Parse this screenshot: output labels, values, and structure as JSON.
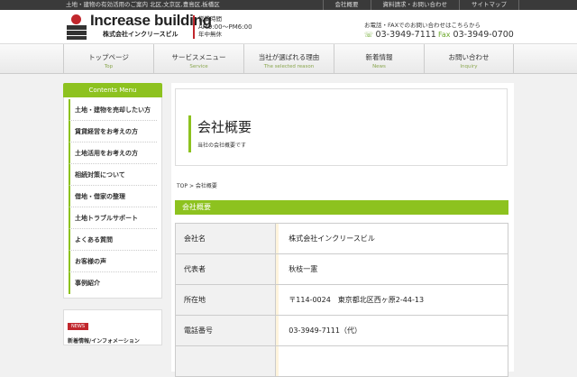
{
  "topbar": {
    "tagline": "土地・建物の有効活用のご案内 北区,文京区,豊島区,板橋区",
    "links": [
      "会社概要",
      "資料請求・お問い合わせ",
      "サイトマップ"
    ]
  },
  "header": {
    "logo_name": "Increase building",
    "logo_sub": "株式会社インクリースビル",
    "hours_label": "営業時間",
    "hours_time": "AM9:00～PM6:00",
    "hours_note": "年中無休",
    "contact_lead": "お電話・FAXでのお問い合わせはこちらから",
    "tel": "03-3949-7111",
    "fax_label": "Fax",
    "fax": "03-3949-0700"
  },
  "nav": [
    {
      "ja": "トップページ",
      "en": "Top"
    },
    {
      "ja": "サービスメニュー",
      "en": "Service"
    },
    {
      "ja": "当社が選ばれる理由",
      "en": "The selected reason"
    },
    {
      "ja": "新着情報",
      "en": "News"
    },
    {
      "ja": "お問い合わせ",
      "en": "Inquiry"
    }
  ],
  "sidebar": {
    "title": "Contents Menu",
    "items": [
      "土地・建物を売却したい方",
      "賃貸経営をお考えの方",
      "土地活用をお考えの方",
      "相続対策について",
      "借地・借家の整理",
      "土地トラブルサポート",
      "よくある質問",
      "お客様の声",
      "事例紹介"
    ],
    "news_badge": "NEWS",
    "news_link": "新着情報/インフォメーション"
  },
  "main": {
    "title": "会社概要",
    "subtitle": "当社の会社概要です",
    "breadcrumb_home": "TOP",
    "breadcrumb_sep": ">",
    "breadcrumb_current": "会社概要",
    "section_heading": "会社概要",
    "rows": [
      {
        "key": "会社名",
        "value": "株式会社インクリースビル"
      },
      {
        "key": "代表者",
        "value": "秋枝一憲"
      },
      {
        "key": "所在地",
        "value": "〒114-0024　東京都北区西ヶ原2-44-13"
      },
      {
        "key": "電話番号",
        "value": "03-3949-7111（代）"
      },
      {
        "key": "",
        "value": ""
      }
    ]
  }
}
